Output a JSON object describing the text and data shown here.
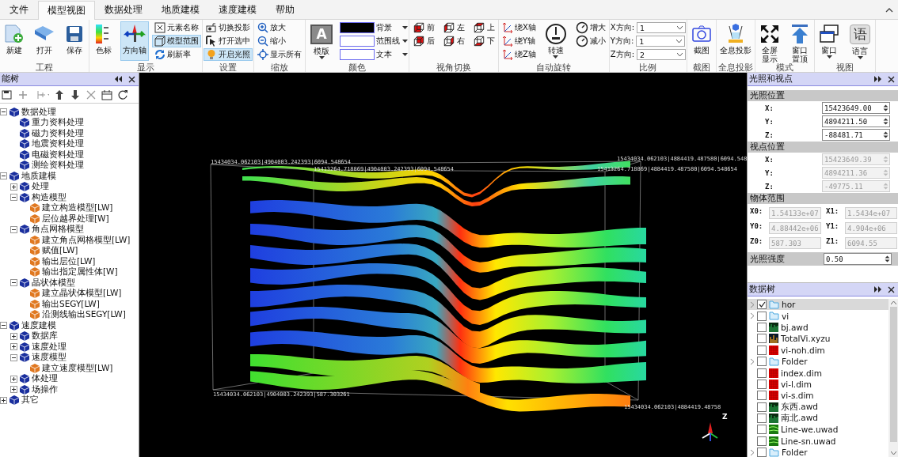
{
  "tabs": [
    {
      "label": "文件",
      "selected": false
    },
    {
      "label": "模型视图",
      "selected": true
    },
    {
      "label": "数据处理",
      "selected": false
    },
    {
      "label": "地质建模",
      "selected": false
    },
    {
      "label": "速度建模",
      "selected": false
    },
    {
      "label": "帮助",
      "selected": false
    }
  ],
  "ribbon": {
    "groups": [
      {
        "label": "工程",
        "items": [
          {
            "kind": "large",
            "label": "新建",
            "active": false
          },
          {
            "kind": "large",
            "label": "打开",
            "active": false
          },
          {
            "kind": "large",
            "label": "保存",
            "active": false
          }
        ]
      },
      {
        "label": "显示",
        "items": [
          {
            "kind": "large",
            "label": "色标",
            "active": false
          },
          {
            "kind": "large",
            "label": "方向轴",
            "active": true
          },
          {
            "kind": "small",
            "label": "元素名称",
            "active": false
          },
          {
            "kind": "small",
            "label": "模型范围",
            "active": true
          },
          {
            "kind": "small",
            "label": "刷新率",
            "active": false
          }
        ]
      },
      {
        "label": "设置",
        "items": [
          {
            "kind": "small",
            "label": "切换投影",
            "active": false
          },
          {
            "kind": "small",
            "label": "打开选中",
            "active": false
          },
          {
            "kind": "small",
            "label": "开启光照",
            "active": true
          }
        ]
      },
      {
        "label": "缩放",
        "items": [
          {
            "kind": "small",
            "label": "放大",
            "active": false
          },
          {
            "kind": "small",
            "label": "缩小",
            "active": false
          },
          {
            "kind": "small",
            "label": "显示所有",
            "active": false
          }
        ]
      },
      {
        "label": "颜色",
        "items": [
          {
            "kind": "large",
            "label": "模版",
            "glyph": "A",
            "dropdown": true,
            "active": false
          },
          {
            "kind": "swatch",
            "label": "背景",
            "color": "#000000"
          },
          {
            "kind": "swatch",
            "label": "范围线",
            "color": "#ffffff"
          },
          {
            "kind": "swatch",
            "label": "文本",
            "color": "#ffffff"
          }
        ]
      },
      {
        "label": "视角切换",
        "items": [
          {
            "kind": "view",
            "label": "前"
          },
          {
            "kind": "view",
            "label": "后"
          },
          {
            "kind": "view",
            "label": "左"
          },
          {
            "kind": "view",
            "label": "右"
          },
          {
            "kind": "view",
            "label": "上"
          },
          {
            "kind": "view",
            "label": "下"
          }
        ]
      },
      {
        "label": "自动旋转",
        "items": [
          {
            "kind": "small",
            "label": "绕X轴",
            "active": false
          },
          {
            "kind": "small",
            "label": "绕Y轴",
            "active": false
          },
          {
            "kind": "small",
            "label": "绕Z轴",
            "active": false
          },
          {
            "kind": "large",
            "label": "转速",
            "dropdown": true,
            "active": false
          },
          {
            "kind": "dial",
            "label": "增大"
          },
          {
            "kind": "dial",
            "label": "减小"
          }
        ]
      },
      {
        "label": "比例",
        "items": [
          {
            "kind": "scale",
            "label": "X方向:",
            "value": "1"
          },
          {
            "kind": "scale",
            "label": "Y方向:",
            "value": "1"
          },
          {
            "kind": "scale",
            "label": "Z方向:",
            "value": "2"
          }
        ]
      },
      {
        "label": "截图",
        "items": [
          {
            "kind": "large",
            "label": "截图",
            "active": false
          }
        ]
      },
      {
        "label": "全息投影",
        "items": [
          {
            "kind": "large",
            "label": "全息投影",
            "active": false
          }
        ]
      },
      {
        "label": "模式",
        "items": [
          {
            "kind": "tall",
            "label": "全屏显示",
            "active": false
          },
          {
            "kind": "tall",
            "label": "窗口置顶",
            "active": false
          }
        ]
      },
      {
        "label": "视图",
        "items": [
          {
            "kind": "large",
            "label": "窗口",
            "dropdown": true,
            "active": false
          },
          {
            "kind": "large",
            "label": "语言",
            "glyph": "语",
            "dropdown": true,
            "active": false
          }
        ]
      }
    ]
  },
  "function_tree": {
    "title": "能树",
    "nodes": [
      {
        "label": "数据处理",
        "kind": "module",
        "expanded": true,
        "children": [
          {
            "label": "重力资料处理",
            "kind": "module"
          },
          {
            "label": "磁力资料处理",
            "kind": "module"
          },
          {
            "label": "地震资料处理",
            "kind": "module"
          },
          {
            "label": "电磁资料处理",
            "kind": "module"
          },
          {
            "label": "测绘资料处理",
            "kind": "module"
          }
        ]
      },
      {
        "label": "地质建模",
        "kind": "module",
        "expanded": true,
        "children": [
          {
            "label": "处理",
            "kind": "module",
            "expanded": false
          },
          {
            "label": "构造模型",
            "kind": "module",
            "expanded": true,
            "children": [
              {
                "label": "建立构造模型[LW]",
                "kind": "tool"
              },
              {
                "label": "层位越界处理[W]",
                "kind": "tool"
              }
            ]
          },
          {
            "label": "角点网格模型",
            "kind": "module",
            "expanded": true,
            "children": [
              {
                "label": "建立角点网格模型[LW]",
                "kind": "tool"
              },
              {
                "label": "赋值[LW]",
                "kind": "tool"
              },
              {
                "label": "输出层位[LW]",
                "kind": "tool"
              },
              {
                "label": "输出指定属性体[W]",
                "kind": "tool"
              }
            ]
          },
          {
            "label": "晶状体模型",
            "kind": "module",
            "expanded": true,
            "children": [
              {
                "label": "建立晶状体模型[LW]",
                "kind": "tool"
              },
              {
                "label": "输出SEGY[LW]",
                "kind": "tool"
              },
              {
                "label": "沿测线输出SEGY[LW]",
                "kind": "tool"
              }
            ]
          }
        ]
      },
      {
        "label": "速度建模",
        "kind": "module",
        "expanded": true,
        "children": [
          {
            "label": "数据库",
            "kind": "module",
            "expanded": false
          },
          {
            "label": "速度处理",
            "kind": "module",
            "expanded": false
          },
          {
            "label": "速度模型",
            "kind": "module",
            "expanded": true,
            "children": [
              {
                "label": "建立速度模型[LW]",
                "kind": "tool"
              }
            ]
          },
          {
            "label": "体处理",
            "kind": "module",
            "expanded": false
          },
          {
            "label": "场操作",
            "kind": "module",
            "expanded": false
          }
        ]
      },
      {
        "label": "其它",
        "kind": "module",
        "expanded": false
      }
    ]
  },
  "viewport": {
    "coordinate_labels": [
      "15434034.062103|4904003.242393|6094.548654",
      "15413264.718869|4904003.242393|6094.548654",
      "15434034.062103|4884419.487580|6094.548",
      "15413264.718869|4884419.487580|6094.548654",
      "15434034.062103|4904003.242393|587.303261",
      "15434034.062103|4884419.48758"
    ],
    "axis_label": "Z"
  },
  "light_panel": {
    "title": "光照和视点",
    "sections": [
      {
        "title": "光照位置",
        "kind": "list",
        "fields": [
          {
            "label": "X:",
            "value": "15423649.00",
            "disabled": false
          },
          {
            "label": "Y:",
            "value": "4894211.50",
            "disabled": false
          },
          {
            "label": "Z:",
            "value": "-88481.71",
            "disabled": false
          }
        ]
      },
      {
        "title": "视点位置",
        "kind": "list",
        "fields": [
          {
            "label": "X:",
            "value": "15423649.39",
            "disabled": true
          },
          {
            "label": "Y:",
            "value": "4894211.36",
            "disabled": true
          },
          {
            "label": "Z:",
            "value": "-49775.11",
            "disabled": true
          }
        ]
      },
      {
        "title": "物体范围",
        "kind": "grid",
        "fields": [
          {
            "label": "X0:",
            "value": "1.54133e+07",
            "disabled": true
          },
          {
            "label": "X1:",
            "value": "1.5434e+07",
            "disabled": true
          },
          {
            "label": "Y0:",
            "value": "4.88442e+06",
            "disabled": true
          },
          {
            "label": "Y1:",
            "value": "4.904e+06",
            "disabled": true
          },
          {
            "label": "Z0:",
            "value": "587.303",
            "disabled": true
          },
          {
            "label": "Z1:",
            "value": "6094.55",
            "disabled": true
          }
        ]
      },
      {
        "title": "光照强度",
        "kind": "inline",
        "fields": [
          {
            "value": "0.50",
            "disabled": false
          }
        ]
      }
    ]
  },
  "data_tree": {
    "title": "数据树",
    "items": [
      {
        "label": "hor",
        "kind": "folder",
        "checked": true,
        "selected": true,
        "has_children": true
      },
      {
        "label": "vi",
        "kind": "folder",
        "checked": false,
        "selected": false,
        "has_children": true
      },
      {
        "label": "bj.awd",
        "kind": "wave",
        "checked": false,
        "selected": false,
        "has_children": false
      },
      {
        "label": "TotalVi.xyzu",
        "kind": "bars",
        "checked": false,
        "selected": false,
        "has_children": false
      },
      {
        "label": "vi-noh.dim",
        "kind": "grid",
        "checked": false,
        "selected": false,
        "has_children": false
      },
      {
        "label": "Folder",
        "kind": "folder",
        "checked": false,
        "selected": false,
        "has_children": true
      },
      {
        "label": "index.dim",
        "kind": "grid",
        "checked": false,
        "selected": false,
        "has_children": false
      },
      {
        "label": "vi-l.dim",
        "kind": "grid",
        "checked": false,
        "selected": false,
        "has_children": false
      },
      {
        "label": "vi-s.dim",
        "kind": "grid",
        "checked": false,
        "selected": false,
        "has_children": false
      },
      {
        "label": "东西.awd",
        "kind": "wave",
        "checked": false,
        "selected": false,
        "has_children": false
      },
      {
        "label": "南北.awd",
        "kind": "wave",
        "checked": false,
        "selected": false,
        "has_children": false
      },
      {
        "label": "Line-we.uwad",
        "kind": "line",
        "checked": false,
        "selected": false,
        "has_children": false
      },
      {
        "label": "Line-sn.uwad",
        "kind": "line",
        "checked": false,
        "selected": false,
        "has_children": false
      },
      {
        "label": "Folder",
        "kind": "folder",
        "checked": false,
        "selected": false,
        "has_children": true
      }
    ]
  }
}
